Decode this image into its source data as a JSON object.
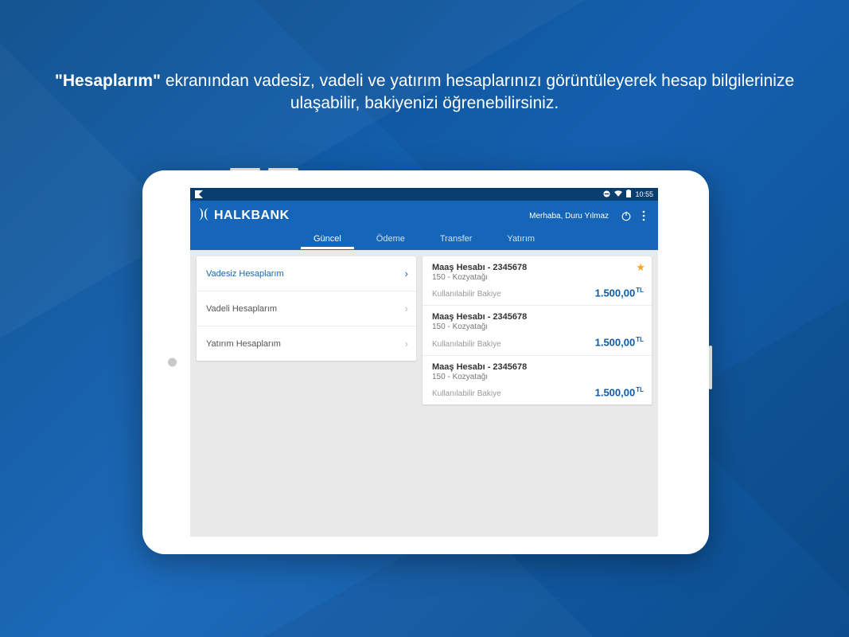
{
  "promo": {
    "bold": "\"Hesaplarım\"",
    "rest": " ekranından vadesiz, vadeli ve yatırım hesaplarınızı görüntüleyerek hesap bilgilerinize ulaşabilir, bakiyenizi öğrenebilirsiniz."
  },
  "statusbar": {
    "time": "10:55"
  },
  "appbar": {
    "brand": "HALKBANK",
    "greeting": "Merhaba, Duru Yılmaz"
  },
  "tabs": [
    {
      "label": "Güncel",
      "active": true
    },
    {
      "label": "Ödeme",
      "active": false
    },
    {
      "label": "Transfer",
      "active": false
    },
    {
      "label": "Yatırım",
      "active": false
    }
  ],
  "sidebar": [
    {
      "label": "Vadesiz Hesaplarım",
      "active": true
    },
    {
      "label": "Vadeli Hesaplarım",
      "active": false
    },
    {
      "label": "Yatırım Hesaplarım",
      "active": false
    }
  ],
  "accounts": [
    {
      "title": "Maaş Hesabı - 2345678",
      "branch": "150 - Kozyatağı",
      "label": "Kullanılabilir Bakiye",
      "balance": "1.500,00",
      "currency": "TL",
      "starred": true
    },
    {
      "title": "Maaş Hesabı - 2345678",
      "branch": "150 - Kozyatağı",
      "label": "Kullanılabilir Bakiye",
      "balance": "1.500,00",
      "currency": "TL",
      "starred": false
    },
    {
      "title": "Maaş Hesabı - 2345678",
      "branch": "150 - Kozyatağı",
      "label": "Kullanılabilir Bakiye",
      "balance": "1.500,00",
      "currency": "TL",
      "starred": false
    }
  ]
}
